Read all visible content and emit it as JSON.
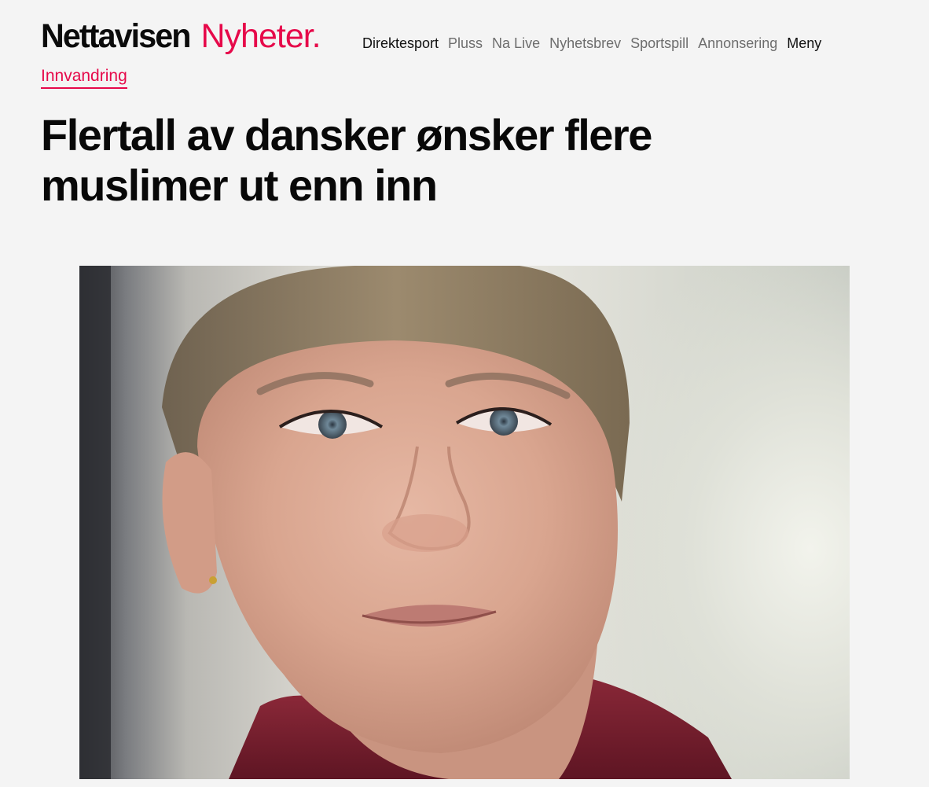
{
  "header": {
    "brand_name": "Nettavisen",
    "brand_section": "Nyheter.",
    "nav": [
      {
        "label": "Direktesport"
      },
      {
        "label": "Pluss"
      },
      {
        "label": "Na Live"
      },
      {
        "label": "Nyhetsbrev"
      },
      {
        "label": "Sportspill"
      },
      {
        "label": "Annonsering"
      },
      {
        "label": "Meny"
      }
    ]
  },
  "article": {
    "kicker": "Innvandring",
    "headline": "Flertall av dansker ønsker flere muslimer ut enn inn"
  },
  "colors": {
    "accent": "#e6094a",
    "background": "#f4f4f4",
    "text": "#0b0b0b",
    "nav_muted": "#6d6d6d"
  }
}
